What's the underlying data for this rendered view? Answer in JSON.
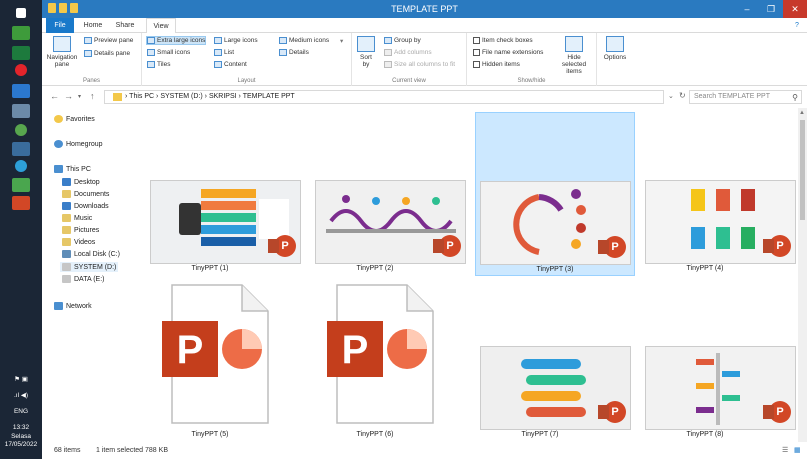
{
  "window": {
    "title": "TEMPLATE PPT",
    "help": "?"
  },
  "taskbar": {
    "time": "13:32",
    "day": "Selasa",
    "date": "17/05/2022",
    "lang": "ENG"
  },
  "tabs": [
    {
      "label": "File"
    },
    {
      "label": "Home"
    },
    {
      "label": "Share"
    },
    {
      "label": "View"
    }
  ],
  "ribbon": {
    "panes": {
      "group": "Panes",
      "navigation_pane": "Navigation pane",
      "preview_pane": "Preview pane",
      "details_pane": "Details pane"
    },
    "layout": {
      "group": "Layout",
      "extra_large_icons": "Extra large icons",
      "large_icons": "Large icons",
      "medium_icons": "Medium icons",
      "small_icons": "Small icons",
      "list": "List",
      "details": "Details",
      "tiles": "Tiles",
      "content": "Content"
    },
    "current_view": {
      "group": "Current view",
      "sort_by": "Sort by",
      "group_by": "Group by",
      "add_columns": "Add columns",
      "size_all_columns": "Size all columns to fit"
    },
    "show_hide": {
      "group": "Show/hide",
      "item_check_boxes": "Item check boxes",
      "file_name_extensions": "File name extensions",
      "hidden_items": "Hidden items",
      "hide_selected_items": "Hide selected items"
    },
    "options": "Options"
  },
  "address": {
    "path": [
      "This PC",
      "SYSTEM (D:)",
      "SKRIPSI",
      "TEMPLATE PPT"
    ],
    "search_placeholder": "Search TEMPLATE PPT"
  },
  "nav_pane": {
    "favorites": "Favorites",
    "homegroup": "Homegroup",
    "this_pc": "This PC",
    "items": [
      "Desktop",
      "Documents",
      "Downloads",
      "Music",
      "Pictures",
      "Videos",
      "Local Disk (C:)",
      "SYSTEM (D:)",
      "DATA (E:)"
    ],
    "network": "Network"
  },
  "files": [
    {
      "name": "TinyPPT (1)"
    },
    {
      "name": "TinyPPT (2)"
    },
    {
      "name": "TinyPPT (3)"
    },
    {
      "name": "TinyPPT (4)"
    },
    {
      "name": "TinyPPT (5)"
    },
    {
      "name": "TinyPPT (6)"
    },
    {
      "name": "TinyPPT (7)"
    },
    {
      "name": "TinyPPT (8)"
    }
  ],
  "status": {
    "count": "68 items",
    "selected": "1 item selected  788 KB"
  },
  "colors": {
    "accent": "#1979ca",
    "selection": "#cce8ff",
    "powerpoint": "#d24726"
  }
}
